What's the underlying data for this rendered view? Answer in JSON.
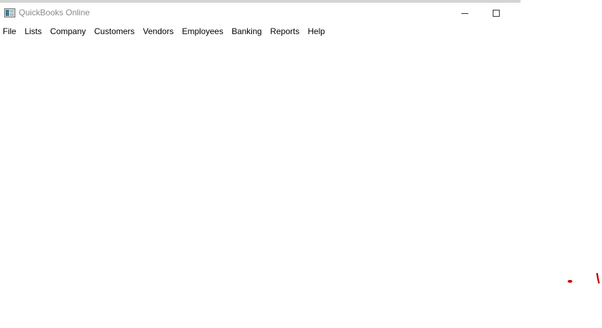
{
  "window": {
    "title": "QuickBooks Online",
    "app_icon": "quickbooks-app-icon",
    "controls": {
      "minimize_icon": "minimize-icon",
      "maximize_icon": "maximize-icon"
    }
  },
  "menubar": {
    "items": [
      {
        "label": "File"
      },
      {
        "label": "Lists"
      },
      {
        "label": "Company"
      },
      {
        "label": "Customers"
      },
      {
        "label": "Vendors"
      },
      {
        "label": "Employees"
      },
      {
        "label": "Banking"
      },
      {
        "label": "Reports"
      },
      {
        "label": "Help"
      }
    ]
  },
  "colors": {
    "title_text": "#8a8a8a",
    "menu_text": "#000000",
    "background": "#ffffff",
    "annotation_marks": "#cc0000"
  }
}
